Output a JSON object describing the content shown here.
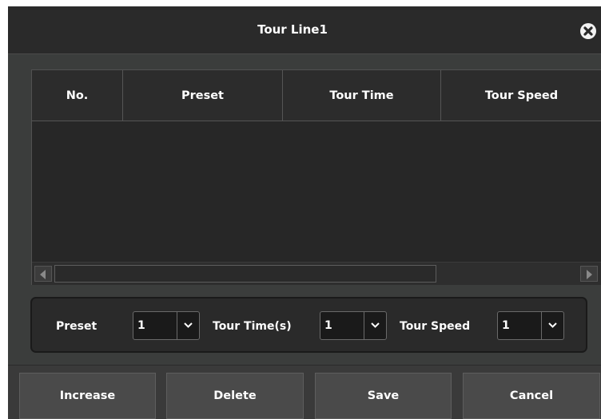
{
  "dialog": {
    "title": "Tour Line1"
  },
  "table": {
    "columns": [
      "No.",
      "Preset",
      "Tour Time",
      "Tour Speed"
    ],
    "rows": []
  },
  "settings": {
    "preset_label": "Preset",
    "preset_value": "1",
    "tour_time_label": "Tour Time(s)",
    "tour_time_value": "1",
    "tour_speed_label": "Tour Speed",
    "tour_speed_value": "1"
  },
  "buttons": {
    "increase": "Increase",
    "delete": "Delete",
    "save": "Save",
    "cancel": "Cancel"
  },
  "icons": {
    "close": "close-icon",
    "dropdown": "chevron-down-icon",
    "scroll_left": "arrow-left-icon",
    "scroll_right": "arrow-right-icon"
  },
  "colors": {
    "dialog_bg": "#3b3d3c",
    "titlebar_bg": "#2a2a2a",
    "table_bg": "#272727",
    "button_bg": "#4a4a4a"
  }
}
